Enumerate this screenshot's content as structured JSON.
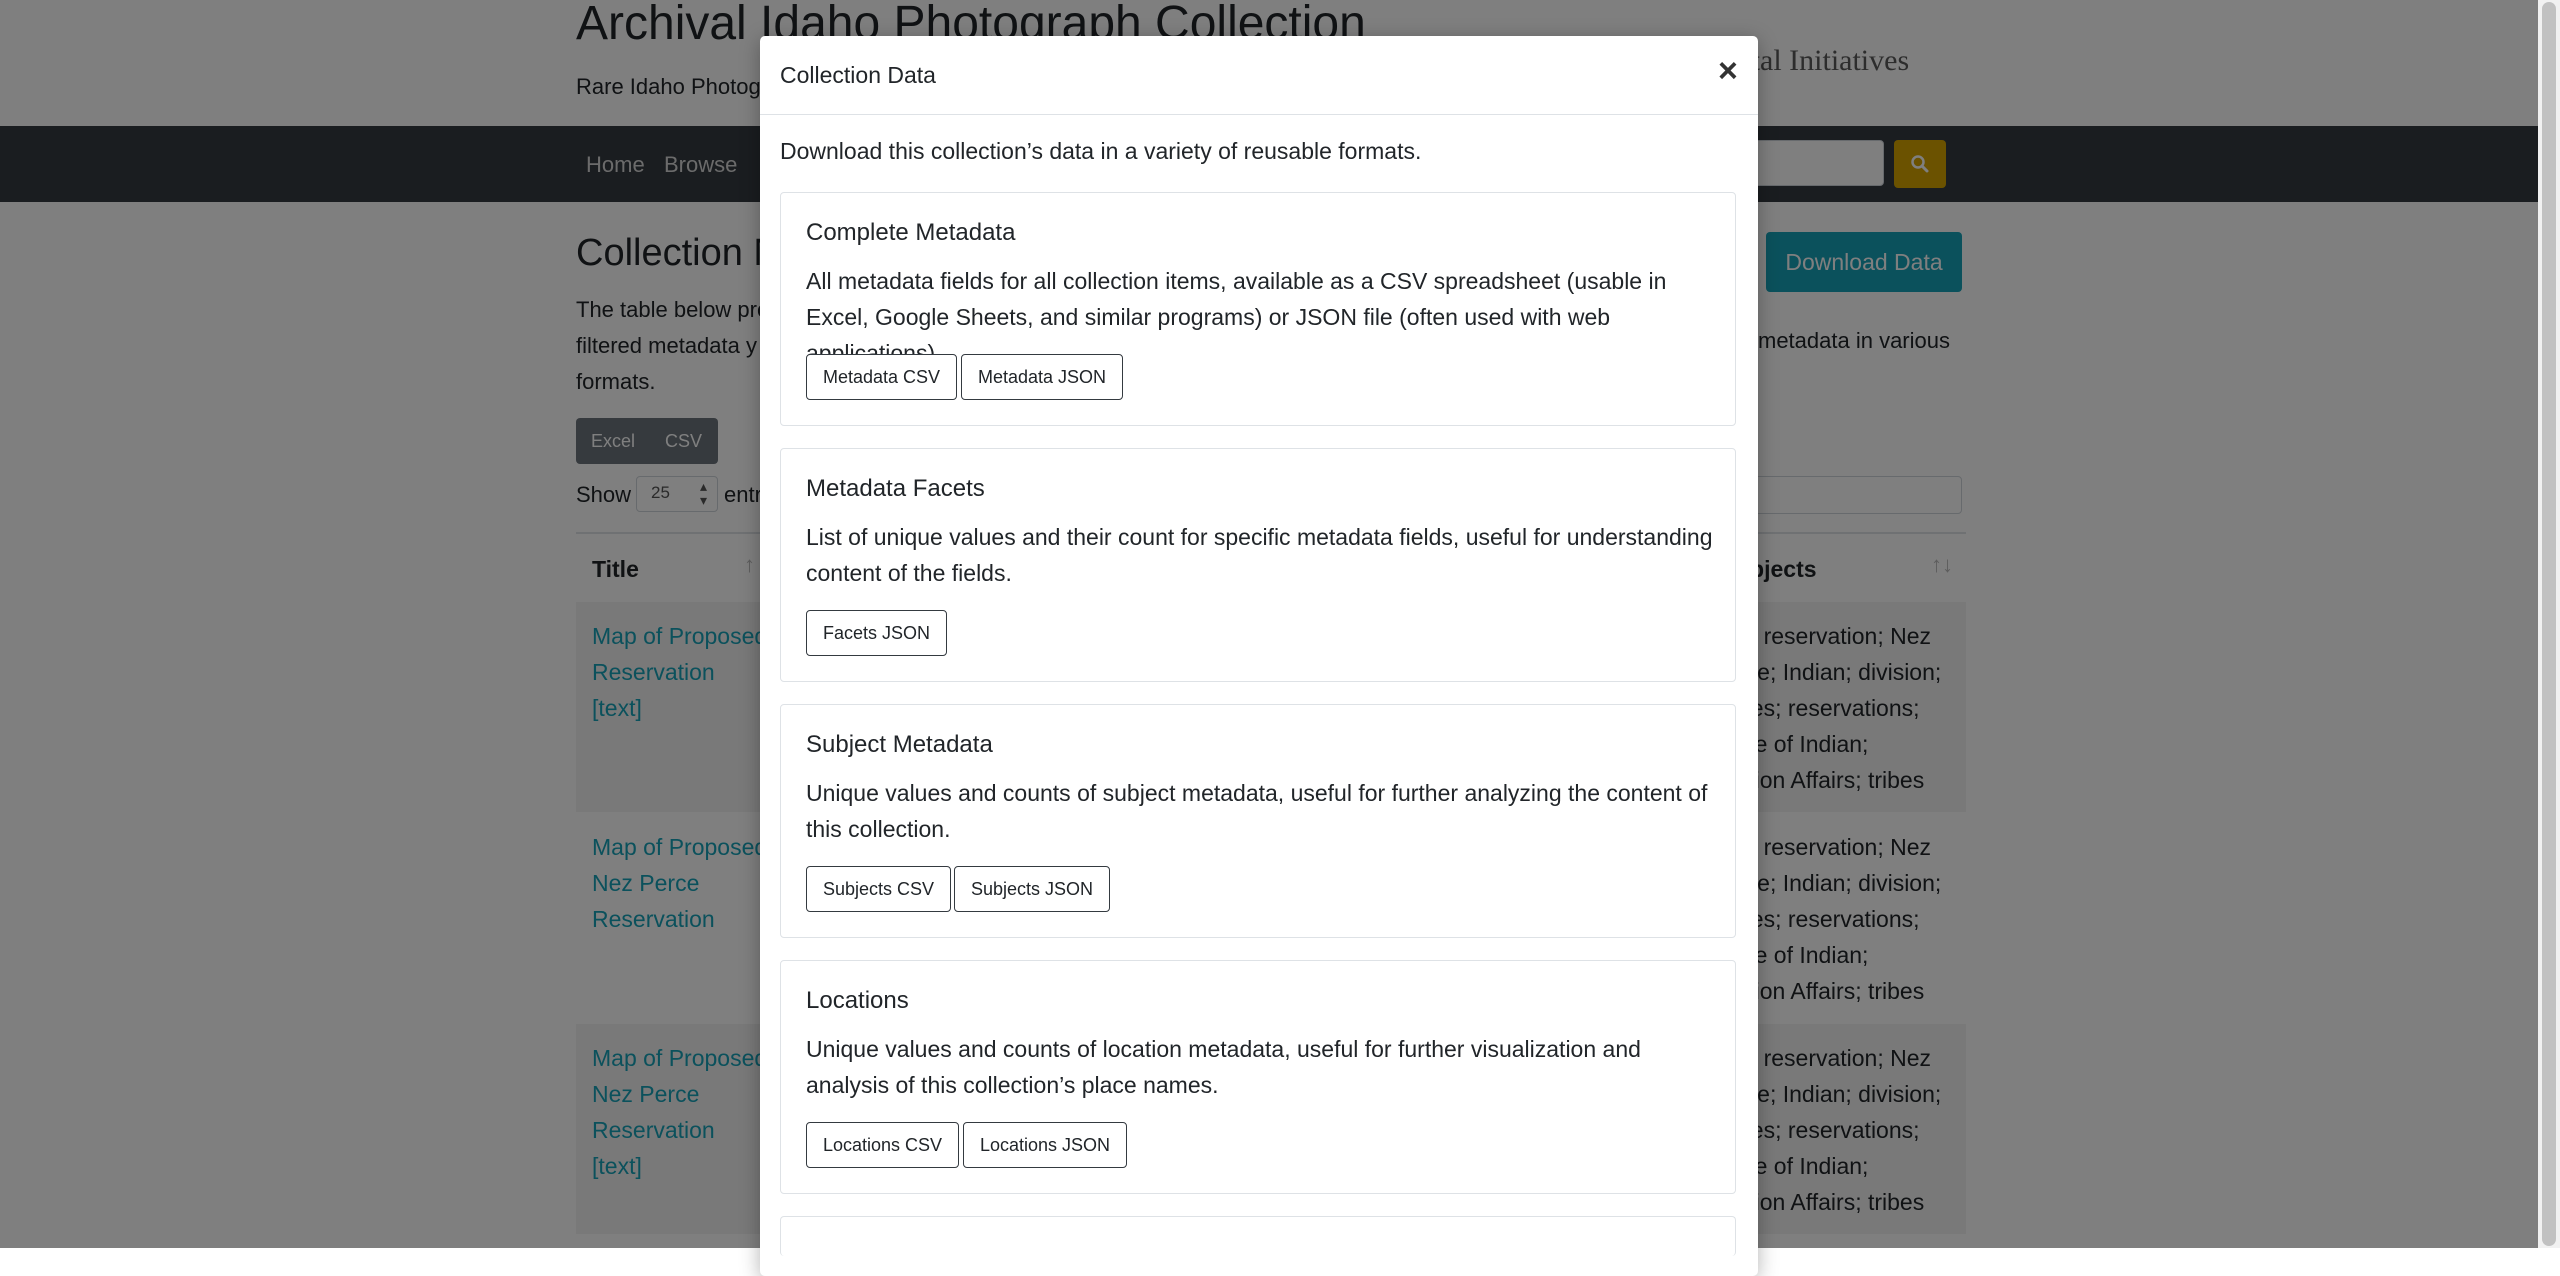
{
  "site": {
    "title": "Archival Idaho Photograph Collection",
    "subtitle": "Rare Idaho Photogr",
    "logo_text": "igital Initiatives"
  },
  "nav": {
    "items": [
      "Home",
      "Browse"
    ]
  },
  "main": {
    "heading": "Collection M",
    "download_label": "Download Data",
    "intro_lines": [
      "The table below pro",
      "filtered metadata y",
      "formats."
    ],
    "intro_right": "metadata in various",
    "export_buttons": [
      "Excel",
      "CSV"
    ],
    "show_label": "Show",
    "show_value": "25",
    "entries_label": "entr",
    "columns": {
      "title": "Title",
      "subjects": "ubjects"
    },
    "rows": [
      {
        "title": [
          "Map of Proposed",
          "Reservation",
          "[text]"
        ],
        "subjects": [
          "p; reservation; Nez",
          "rce; Indian; division;",
          "bes; reservations;",
          "ice of Indian;",
          "ision Affairs; tribes"
        ]
      },
      {
        "title": [
          "Map of Proposed",
          "Nez Perce",
          "Reservation"
        ],
        "subjects": [
          "p; reservation; Nez",
          "rce; Indian; division;",
          "bes; reservations;",
          "ice of Indian;",
          "ision Affairs; tribes"
        ]
      },
      {
        "title": [
          "Map of Proposed",
          "Nez Perce",
          "Reservation",
          "[text]"
        ],
        "subjects": [
          "p; reservation; Nez",
          "rce; Indian; division;",
          "bes; reservations;",
          "ice of Indian;",
          "ision Affairs; tribes"
        ]
      }
    ]
  },
  "modal": {
    "title": "Collection Data",
    "close_label": "×",
    "intro": "Download this collection’s data in a variety of reusable formats.",
    "cards": [
      {
        "title": "Complete Metadata",
        "text": "All metadata fields for all collection items, available as a CSV spreadsheet (usable in Excel, Google Sheets, and similar programs) or JSON file (often used with web applications).",
        "buttons": [
          "Metadata CSV",
          "Metadata JSON"
        ]
      },
      {
        "title": "Metadata Facets",
        "text": "List of unique values and their count for specific metadata fields, useful for understanding content of the fields.",
        "buttons": [
          "Facets JSON"
        ]
      },
      {
        "title": "Subject Metadata",
        "text": "Unique values and counts of subject metadata, useful for further analyzing the content of this collection.",
        "buttons": [
          "Subjects CSV",
          "Subjects JSON"
        ]
      },
      {
        "title": "Locations",
        "text": "Unique values and counts of location metadata, useful for further visualization and analysis of this collection’s place names.",
        "buttons": [
          "Locations CSV",
          "Locations JSON"
        ]
      }
    ]
  },
  "colors": {
    "accent": "#17a2b8",
    "navbar": "#343a40",
    "search_button": "#d6a400"
  },
  "icons": {
    "search": "search-icon",
    "close": "close-icon"
  }
}
